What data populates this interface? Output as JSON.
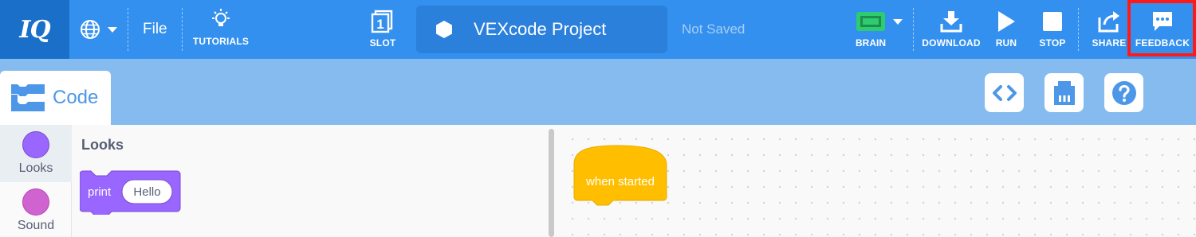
{
  "menubar": {
    "logo_text": "IQ",
    "file_label": "File",
    "tutorials_label": "TUTORIALS",
    "slot_label": "SLOT",
    "slot_number": "1",
    "project_title": "VEXcode Project",
    "save_status": "Not Saved",
    "brain_label": "BRAIN",
    "download_label": "DOWNLOAD",
    "run_label": "RUN",
    "stop_label": "STOP",
    "share_label": "SHARE",
    "feedback_label": "FEEDBACK",
    "icons": [
      "globe-icon",
      "chevron-down-icon",
      "lightbulb-icon",
      "slot-icon",
      "hexagon-icon",
      "brain-icon",
      "download-icon",
      "run-icon",
      "stop-icon",
      "share-icon",
      "feedback-icon"
    ],
    "colors": {
      "bar": "#3390ee",
      "logo_bg": "#1a6fc9",
      "title_bg": "#2b80dc",
      "brain_green": "#2ecc71",
      "highlight": "#ff1a1a"
    }
  },
  "tabs": {
    "code_label": "Code",
    "tools": [
      "code-view-icon",
      "device-icon",
      "help-icon"
    ]
  },
  "categories": [
    {
      "name": "Looks",
      "color": "#9966ff"
    },
    {
      "name": "Sound",
      "color": "#cf63cf"
    }
  ],
  "flyout": {
    "section_title": "Looks",
    "print_block": {
      "keyword": "print",
      "value": "Hello",
      "color": "#9966ff"
    }
  },
  "workspace": {
    "hat_block": {
      "label": "when started",
      "color": "#ffbf00"
    }
  }
}
